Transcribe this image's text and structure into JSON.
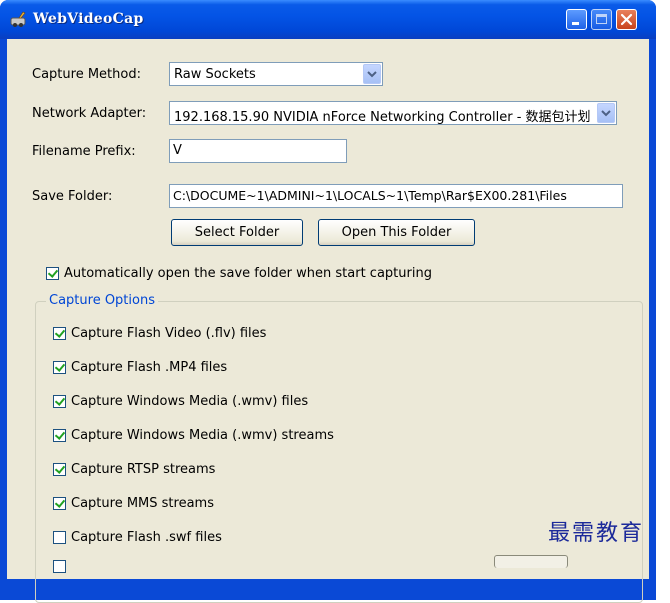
{
  "window": {
    "title": "WebVideoCap"
  },
  "fields": {
    "capture_method": {
      "label": "Capture Method:",
      "value": "Raw Sockets"
    },
    "network_adapter": {
      "label": "Network Adapter:",
      "value": "192.168.15.90  NVIDIA nForce Networking Controller - 数据包计划"
    },
    "filename_prefix": {
      "label": "Filename Prefix:",
      "value": "V"
    },
    "save_folder": {
      "label": "Save Folder:",
      "value": "C:\\DOCUME~1\\ADMINI~1\\LOCALS~1\\Temp\\Rar$EX00.281\\Files"
    }
  },
  "buttons": {
    "select_folder": "Select Folder",
    "open_folder": "Open This Folder"
  },
  "auto_open": {
    "label": "Automatically open the save folder when start capturing",
    "checked": true
  },
  "capture_options": {
    "title": "Capture Options",
    "items": [
      {
        "label": "Capture Flash Video (.flv) files",
        "checked": true
      },
      {
        "label": "Capture Flash .MP4 files",
        "checked": true
      },
      {
        "label": "Capture Windows Media (.wmv) files",
        "checked": true
      },
      {
        "label": "Capture Windows Media (.wmv) streams",
        "checked": true
      },
      {
        "label": "Capture RTSP streams",
        "checked": true
      },
      {
        "label": "Capture MMS streams",
        "checked": true
      },
      {
        "label": "Capture Flash .swf files",
        "checked": false
      }
    ]
  },
  "watermark": "最需教育",
  "colors": {
    "titlebar": "#0454e6",
    "client_bg": "#ece9d8",
    "group_title": "#0046d5",
    "check": "#21a121"
  }
}
